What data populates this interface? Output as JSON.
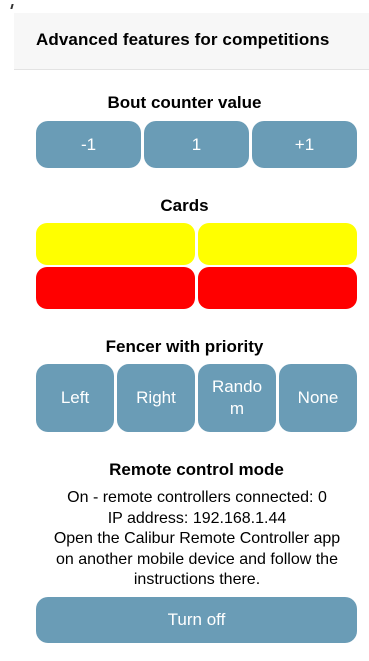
{
  "header": {
    "title": "Advanced features for competitions"
  },
  "bout_counter": {
    "title": "Bout counter value",
    "decrement_label": "-1",
    "value": "1",
    "increment_label": "+1"
  },
  "cards": {
    "title": "Cards",
    "colors": {
      "yellow": "#ffff00",
      "red": "#ff0000"
    },
    "items": [
      "yellow-left",
      "yellow-right",
      "red-left",
      "red-right"
    ]
  },
  "priority": {
    "title": "Fencer with priority",
    "options": {
      "left": "Left",
      "right": "Right",
      "random": "Random",
      "none": "None"
    }
  },
  "remote": {
    "title": "Remote control mode",
    "lines": [
      "On - remote controllers connected: 0",
      "IP address: 192.168.1.44",
      "Open the Calibur Remote Controller app",
      "on another mobile device and follow the",
      "instructions there."
    ],
    "turn_off_label": "Turn off"
  },
  "theme": {
    "button_color": "#6a9cb6",
    "button_text_color": "#ffffff",
    "header_background": "#f7f7f7"
  }
}
